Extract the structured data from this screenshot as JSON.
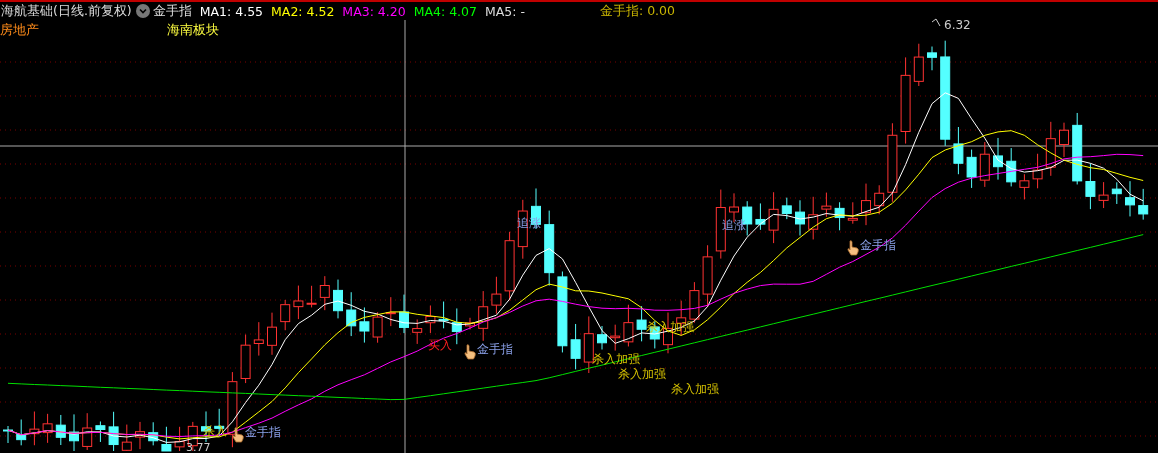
{
  "header": {
    "title": "海航基础(日线.前复权)",
    "indicator": "金手指",
    "moving_averages": [
      {
        "label": "MA1:",
        "value": "4.55",
        "color": "#ffffff"
      },
      {
        "label": "MA2:",
        "value": "4.52",
        "color": "#ffff00"
      },
      {
        "label": "MA3:",
        "value": "4.20",
        "color": "#ff00ff"
      },
      {
        "label": "MA4:",
        "value": "4.07",
        "color": "#00ff00"
      },
      {
        "label": "MA5:",
        "value": "-",
        "color": "#dddddd"
      }
    ],
    "indicator_readout": {
      "label": "金手指:",
      "value": "0.00"
    }
  },
  "tags": [
    {
      "text": "房地产",
      "kind": "industry"
    },
    {
      "text": "海南板块",
      "kind": "region"
    }
  ],
  "chart": {
    "high_label": "6.32",
    "low_label": "3.77",
    "annotations": [
      {
        "text": "追涨",
        "kind": "chase"
      },
      {
        "text": "追涨",
        "kind": "chase"
      },
      {
        "text": "买入",
        "kind": "buy"
      },
      {
        "text": "金手指",
        "kind": "signal"
      },
      {
        "text": "金手指",
        "kind": "signal"
      },
      {
        "text": "杀入加强",
        "kind": "strong"
      },
      {
        "text": "杀入加强",
        "kind": "strong"
      },
      {
        "text": "杀入加强",
        "kind": "strong"
      },
      {
        "text": "杀入加强",
        "kind": "strong"
      },
      {
        "text": "杀入",
        "kind": "strong"
      },
      {
        "text": "金手指",
        "kind": "signal"
      }
    ]
  }
}
